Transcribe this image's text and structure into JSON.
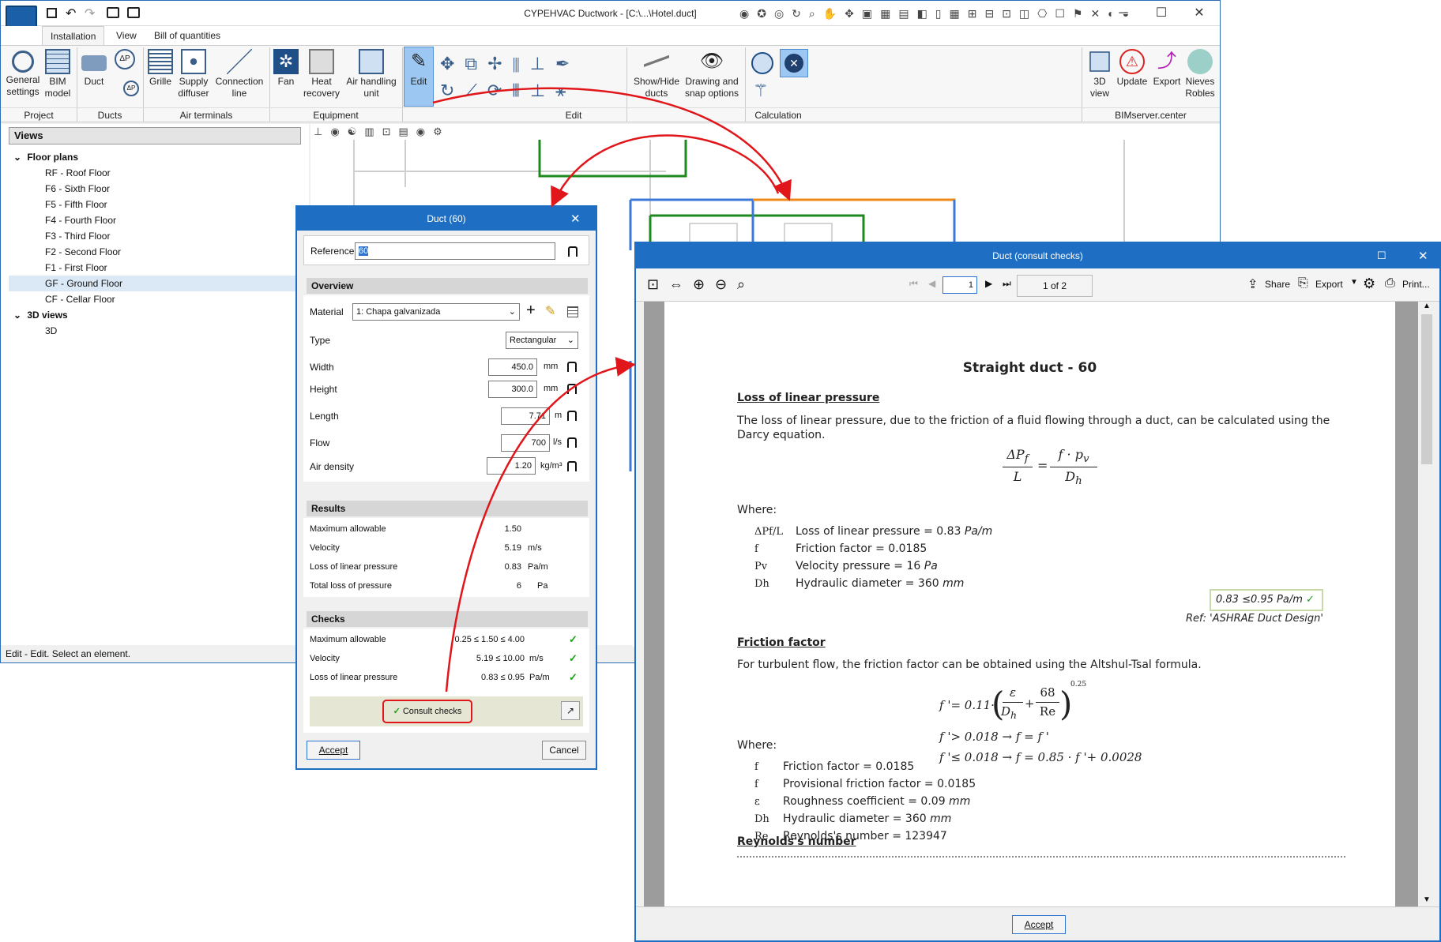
{
  "app": {
    "title": "CYPEHVAC Ductwork - [C:\\...\\Hotel.duct]",
    "tabs": [
      "Installation",
      "View",
      "Bill of quantities"
    ],
    "ribbon": {
      "general_settings": "General settings",
      "bim_model": "BIM model",
      "duct": "Duct",
      "grille": "Grille",
      "supply_diffuser": "Supply diffuser",
      "connection_line": "Connection line",
      "fan": "Fan",
      "heat_recovery": "Heat recovery",
      "air_handling_unit": "Air handling unit",
      "edit": "Edit",
      "show_hide_ducts": "Show/Hide ducts",
      "drawing_snap": "Drawing and snap options",
      "view_3d": "3D view",
      "update": "Update",
      "export": "Export",
      "user": "Nieves Robles"
    },
    "groups": {
      "project": "Project",
      "ducts": "Ducts",
      "air_terminals": "Air terminals",
      "equipment": "Equipment",
      "edit": "Edit",
      "calculation": "Calculation",
      "bimserver": "BIMserver.center"
    },
    "views": {
      "header": "Views",
      "floor_plans": "Floor plans",
      "floors": [
        "RF - Roof Floor",
        "F6 - Sixth Floor",
        "F5 - Fifth Floor",
        "F4 - Fourth Floor",
        "F3 - Third Floor",
        "F2 - Second Floor",
        "F1 - First Floor",
        "GF - Ground Floor",
        "CF - Cellar Floor"
      ],
      "selected_floor": "GF - Ground Floor",
      "views_3d": "3D views",
      "view_3d_item": "3D"
    },
    "status": "Edit - Edit. Select an element."
  },
  "duct_dialog": {
    "title": "Duct (60)",
    "reference_label": "Reference",
    "reference_value": "60",
    "overview": "Overview",
    "material_label": "Material",
    "material_value": "1: Chapa galvanizada",
    "type_label": "Type",
    "type_value": "Rectangular",
    "width_label": "Width",
    "width_value": "450.0",
    "width_unit": "mm",
    "height_label": "Height",
    "height_value": "300.0",
    "height_unit": "mm",
    "length_label": "Length",
    "length_value": "7.71",
    "length_unit": "m",
    "flow_label": "Flow",
    "flow_value": "700",
    "flow_unit": "l/s",
    "density_label": "Air density",
    "density_value": "1.20",
    "density_unit": "kg/m³",
    "results": "Results",
    "r_max_label": "Maximum allowable",
    "r_max_value": "1.50",
    "r_vel_label": "Velocity",
    "r_vel_value": "5.19",
    "r_vel_unit": "m/s",
    "r_loss_label": "Loss of linear pressure",
    "r_loss_value": "0.83",
    "r_loss_unit": "Pa/m",
    "r_total_label": "Total loss of pressure",
    "r_total_value": "6",
    "r_total_unit": "Pa",
    "checks": "Checks",
    "c_max_label": "Maximum allowable",
    "c_max_value": "0.25 ≤ 1.50 ≤ 4.00",
    "c_vel_label": "Velocity",
    "c_vel_value": "5.19 ≤ 10.00",
    "c_vel_unit": "m/s",
    "c_loss_label": "Loss of linear pressure",
    "c_loss_value": "0.83 ≤ 0.95",
    "c_loss_unit": "Pa/m",
    "consult_checks": "Consult checks",
    "accept": "Accept",
    "cancel": "Cancel"
  },
  "consult": {
    "title": "Duct (consult checks)",
    "page_input": "1",
    "page_of": "1 of 2",
    "share": "Share",
    "export": "Export",
    "print": "Print...",
    "accept": "Accept",
    "doc": {
      "title": "Straight duct - 60",
      "s1": "Loss of linear pressure",
      "s1_text": "The loss of linear pressure, due to the friction of a fluid flowing through a duct, can be calculated using the Darcy equation.",
      "where": "Where:",
      "s1_rows": [
        {
          "sym": "ΔPf/L",
          "text": "Loss of linear pressure = 0.83",
          "unit": "Pa/m"
        },
        {
          "sym": "f",
          "text": "Friction factor = 0.0185",
          "unit": ""
        },
        {
          "sym": "Pv",
          "text": "Velocity pressure = 16",
          "unit": "Pa"
        },
        {
          "sym": "Dh",
          "text": "Hydraulic diameter = 360",
          "unit": "mm"
        }
      ],
      "check_box": "0.83 ≤0.95 Pa/m",
      "ref": "Ref: 'ASHRAE Duct Design'",
      "s2": "Friction factor",
      "s2_text": "For turbulent flow, the friction factor can be obtained using the Altshul-Tsal formula.",
      "s2_rows": [
        {
          "sym": "f",
          "text": "Friction factor = 0.0185",
          "unit": ""
        },
        {
          "sym": "f",
          "text": "Provisional friction factor = 0.0185",
          "unit": ""
        },
        {
          "sym": "ε",
          "text": "Roughness coefficient = 0.09",
          "unit": "mm"
        },
        {
          "sym": "Dh",
          "text": "Hydraulic diameter = 360",
          "unit": "mm"
        },
        {
          "sym": "Re",
          "text": "Reynolds's number = 123947",
          "unit": ""
        }
      ],
      "s3": "Reynolds's number"
    }
  },
  "colors": {
    "accent": "#1e6fc4",
    "arrow": "#e0161b",
    "duct_green": "#1c8a1c",
    "duct_blue": "#3c78d8",
    "duct_orange": "#ef8a1a",
    "check": "#1a9e1a"
  }
}
